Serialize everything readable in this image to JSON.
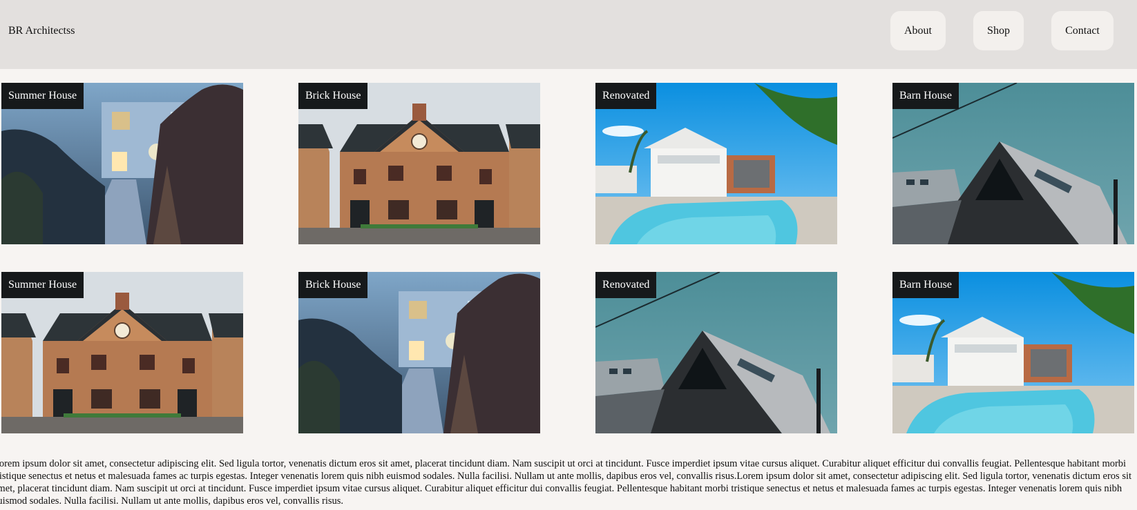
{
  "header": {
    "brand": "BR Architectss",
    "nav": [
      "About",
      "Shop",
      "Contact"
    ]
  },
  "gallery": [
    {
      "label": "Summer House",
      "scene": "summer-house"
    },
    {
      "label": "Brick House",
      "scene": "brick-house"
    },
    {
      "label": "Renovated",
      "scene": "pool-villa"
    },
    {
      "label": "Barn House",
      "scene": "barn-house"
    },
    {
      "label": "Summer House",
      "scene": "brick-house"
    },
    {
      "label": "Brick House",
      "scene": "summer-house"
    },
    {
      "label": "Renovated",
      "scene": "barn-house"
    },
    {
      "label": "Barn House",
      "scene": "pool-villa"
    }
  ],
  "body_text": "Lorem ipsum dolor sit amet, consectetur adipiscing elit. Sed ligula tortor, venenatis dictum eros sit amet, placerat tincidunt diam. Nam suscipit ut orci at tincidunt. Fusce imperdiet ipsum vitae cursus aliquet. Curabitur aliquet efficitur dui convallis feugiat. Pellentesque habitant morbi tristique senectus et netus et malesuada fames ac turpis egestas. Integer venenatis lorem quis nibh euismod sodales. Nulla facilisi. Nullam ut ante mollis, dapibus eros vel, convallis risus.Lorem ipsum dolor sit amet, consectetur adipiscing elit. Sed ligula tortor, venenatis dictum eros sit amet, placerat tincidunt diam. Nam suscipit ut orci at tincidunt. Fusce imperdiet ipsum vitae cursus aliquet. Curabitur aliquet efficitur dui convallis feugiat. Pellentesque habitant morbi tristique senectus et netus et malesuada fames ac turpis egestas. Integer venenatis lorem quis nibh euismod sodales. Nulla facilisi. Nullam ut ante mollis, dapibus eros vel, convallis risus."
}
